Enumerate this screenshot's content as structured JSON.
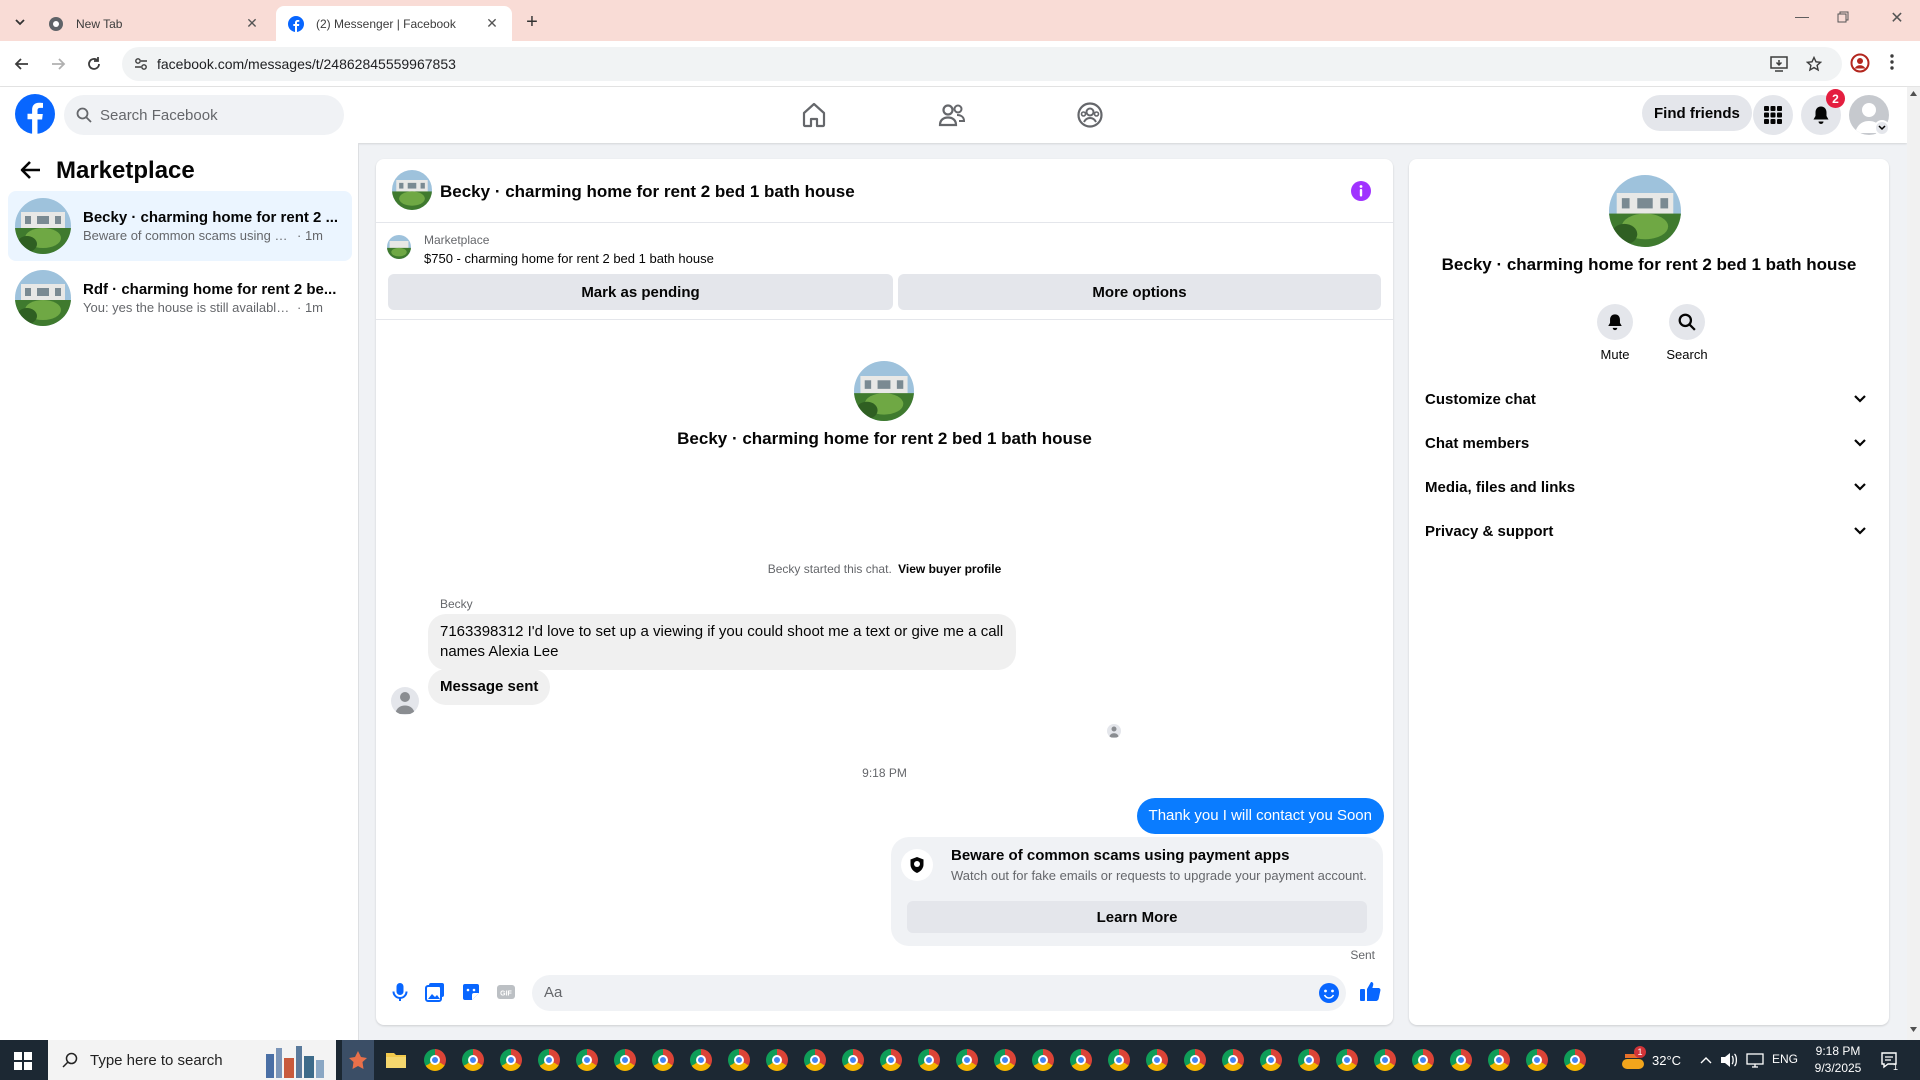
{
  "browser": {
    "tabs": [
      {
        "title": "New Tab"
      },
      {
        "title": "(2) Messenger | Facebook"
      }
    ],
    "url": "facebook.com/messages/t/24862845559967853"
  },
  "header": {
    "search_placeholder": "Search Facebook",
    "find_friends": "Find friends",
    "notification_count": "2"
  },
  "sidebar": {
    "title": "Marketplace",
    "conversations": [
      {
        "name": "Becky · charming home for rent 2 ...",
        "preview": "Beware of common scams using pay...",
        "time": "· 1m"
      },
      {
        "name": "Rdf · charming home for rent 2 be...",
        "preview": "You: yes the house is still available for...",
        "time": "· 1m"
      }
    ]
  },
  "chat": {
    "title": "Becky · charming home for rent 2 bed 1 bath house",
    "listing": {
      "source": "Marketplace",
      "price_title": "$750 - charming home for rent 2 bed 1 bath house"
    },
    "mark_pending": "Mark as pending",
    "more_options": "More options",
    "intro_name": "Becky · charming home for rent 2 bed 1 bath house",
    "started_text": "Becky started this chat.",
    "view_profile": "View buyer profile",
    "sender_name": "Becky",
    "msg1": "7163398312 I'd love to set up a viewing if you could shoot me a text or give me a call names Alexia Lee",
    "msg2": "Message sent",
    "timestamp": "9:18 PM",
    "msg_out": "Thank you I will contact you Soon",
    "scam_title": "Beware of common scams using payment apps",
    "scam_body": "Watch out for fake emails or requests to upgrade your payment account.",
    "learn_more": "Learn More",
    "status": "Sent",
    "composer_placeholder": "Aa"
  },
  "info": {
    "name": "Becky · charming home for rent 2 bed 1 bath house",
    "mute": "Mute",
    "search": "Search",
    "sections": [
      "Customize chat",
      "Chat members",
      "Media, files and links",
      "Privacy & support"
    ]
  },
  "taskbar": {
    "search_placeholder": "Type here to search",
    "temperature": "32°C",
    "language": "ENG",
    "time": "9:18 PM",
    "date": "9/3/2025",
    "notif_count": "1"
  },
  "colors": {
    "fb_blue": "#0866ff",
    "messenger_blue": "#0a7cff",
    "selected_row": "#ebf5ff",
    "tabstrip": "#f9dcd6",
    "info_purple": "#a033ff"
  }
}
